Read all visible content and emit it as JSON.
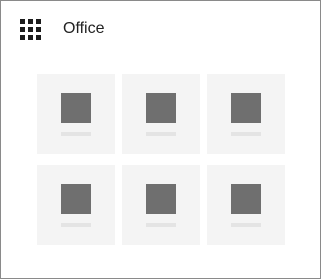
{
  "header": {
    "title": "Office",
    "launcher_icon": "app-launcher-waffle-icon"
  },
  "tiles": {
    "count": 6,
    "state": "loading-placeholder",
    "icon": "placeholder-app-icon",
    "colors": {
      "tile_background": "#f4f4f4",
      "icon": "#6f6f6f",
      "label_bar": "#e4e4e4"
    }
  }
}
